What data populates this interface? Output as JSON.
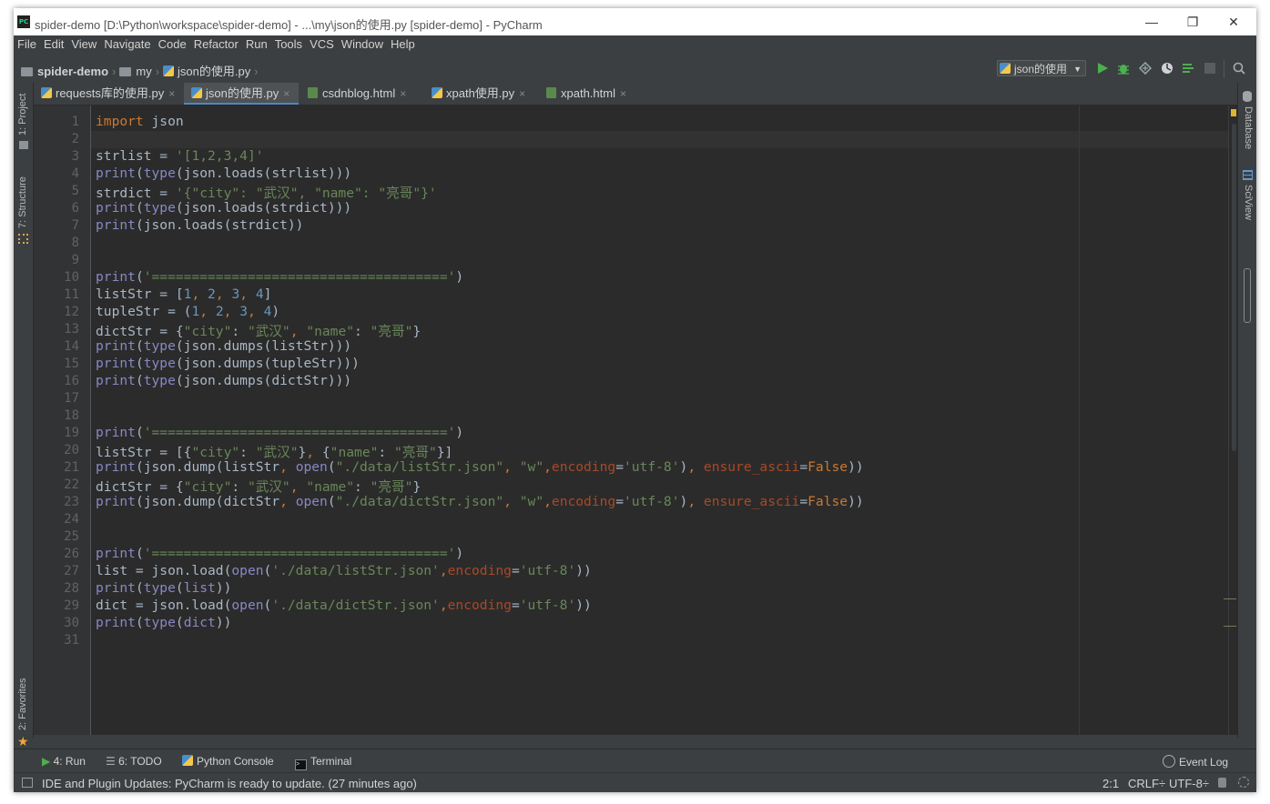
{
  "window": {
    "title": "spider-demo [D:\\Python\\workspace\\spider-demo] - ...\\my\\json的使用.py [spider-demo] - PyCharm",
    "app_icon": "PC",
    "minimize": "—",
    "restore": "❐",
    "close": "✕"
  },
  "menu": {
    "items": [
      "File",
      "Edit",
      "View",
      "Navigate",
      "Code",
      "Refactor",
      "Run",
      "Tools",
      "VCS",
      "Window",
      "Help"
    ]
  },
  "breadcrumb": {
    "project": "spider-demo",
    "folder": "my",
    "file": "json的使用.py"
  },
  "run_config": {
    "label": "json的使用",
    "colors": {
      "run": "#4caf50",
      "debug": "#4caf50"
    }
  },
  "tool_windows": {
    "left": {
      "project": "1: Project",
      "structure": "7: Structure",
      "favorites": "2: Favorites"
    },
    "right": {
      "database": "Database",
      "sciview": "SciView"
    }
  },
  "tabs": [
    {
      "label": "requests库的使用.py",
      "type": "py",
      "active": false,
      "close": "×"
    },
    {
      "label": "json的使用.py",
      "type": "py",
      "active": true,
      "close": "×"
    },
    {
      "label": "csdnblog.html",
      "type": "html",
      "active": false,
      "close": "×"
    },
    {
      "label": "xpath使用.py",
      "type": "py",
      "active": false,
      "close": "×"
    },
    {
      "label": "xpath.html",
      "type": "html",
      "active": false,
      "close": "×"
    }
  ],
  "editor": {
    "line_numbers": [
      "1",
      "2",
      "3",
      "4",
      "5",
      "6",
      "7",
      "8",
      "9",
      "10",
      "11",
      "12",
      "13",
      "14",
      "15",
      "16",
      "17",
      "18",
      "19",
      "20",
      "21",
      "22",
      "23",
      "24",
      "25",
      "26",
      "27",
      "28",
      "29",
      "30",
      "31"
    ],
    "lines": [
      "import json",
      "",
      "strlist = '[1,2,3,4]'",
      "print(type(json.loads(strlist)))",
      "strdict = '{\"city\": \"武汉\", \"name\": \"亮哥\"}'",
      "print(type(json.loads(strdict)))",
      "print(json.loads(strdict))",
      "",
      "",
      "print('=====================================')",
      "listStr = [1, 2, 3, 4]",
      "tupleStr = (1, 2, 3, 4)",
      "dictStr = {\"city\": \"武汉\", \"name\": \"亮哥\"}",
      "print(type(json.dumps(listStr)))",
      "print(type(json.dumps(tupleStr)))",
      "print(type(json.dumps(dictStr)))",
      "",
      "",
      "print('=====================================')",
      "listStr = [{\"city\": \"武汉\"}, {\"name\": \"亮哥\"}]",
      "print(json.dump(listStr, open(\"./data/listStr.json\", \"w\",encoding='utf-8'), ensure_ascii=False))",
      "dictStr = {\"city\": \"武汉\", \"name\": \"亮哥\"}",
      "print(json.dump(dictStr, open(\"./data/dictStr.json\", \"w\",encoding='utf-8'), ensure_ascii=False))",
      "",
      "",
      "print('=====================================')",
      "list = json.load(open('./data/listStr.json',encoding='utf-8'))",
      "print(type(list))",
      "dict = json.load(open('./data/dictStr.json',encoding='utf-8'))",
      "print(type(dict))",
      ""
    ],
    "syntax_colors": {
      "keyword": "#cc7832",
      "string": "#6a8759",
      "number": "#6897bb",
      "builtin": "#8888c6",
      "param": "#aa4926",
      "default": "#a9b7c6"
    }
  },
  "bottom_tools": [
    {
      "label": "4: Run",
      "icon": "run-icon"
    },
    {
      "label": "6: TODO",
      "icon": "todo-icon"
    },
    {
      "label": "Python Console",
      "icon": "python-icon"
    },
    {
      "label": "Terminal",
      "icon": "terminal-icon"
    }
  ],
  "event_log": "Event Log",
  "status": {
    "message": "IDE and Plugin Updates: PyCharm is ready to update. (27 minutes ago)",
    "position": "2:1",
    "line_sep": "CRLF÷",
    "encoding": "UTF-8÷"
  }
}
